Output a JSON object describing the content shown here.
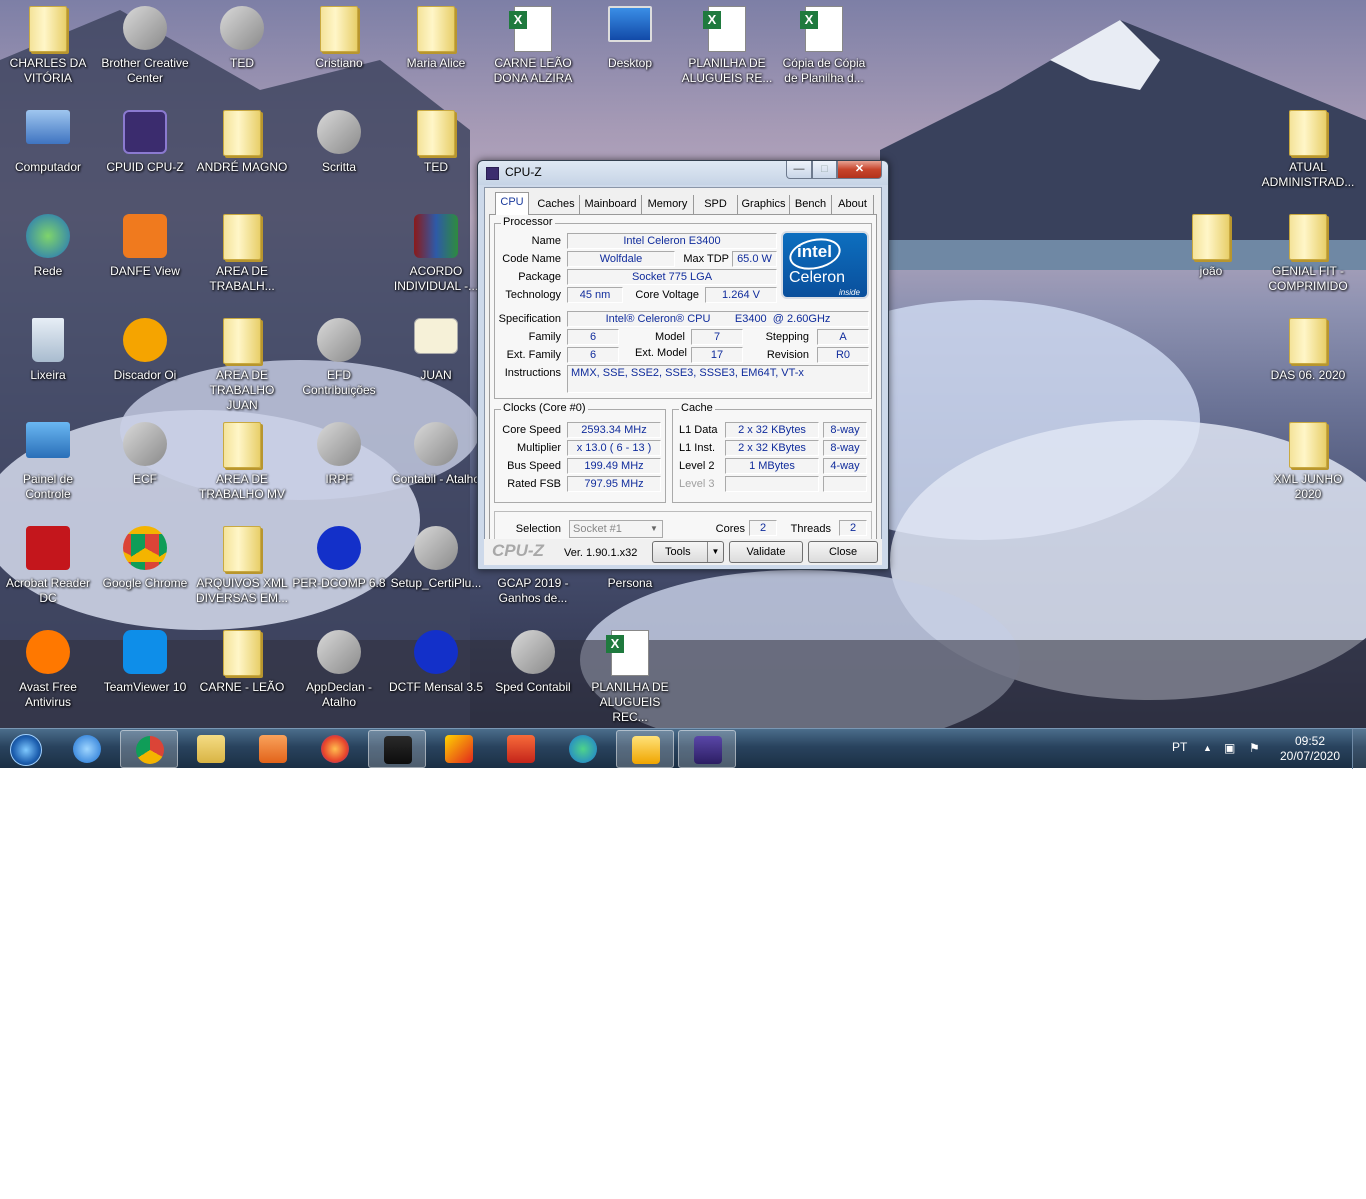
{
  "desktop_icons": [
    {
      "label": "CHARLES DA\nVITÓRIA",
      "icon": "user-folder-icon",
      "col": 0,
      "row": 0
    },
    {
      "label": "Brother Creative\nCenter",
      "icon": "brother-icon",
      "col": 1,
      "row": 0
    },
    {
      "label": "TED",
      "icon": "ted-app-icon",
      "col": 2,
      "row": 0
    },
    {
      "label": "Cristiano",
      "icon": "folder-icon",
      "col": 3,
      "row": 0
    },
    {
      "label": "Maria Alice",
      "icon": "folder-icon",
      "col": 4,
      "row": 0
    },
    {
      "label": "CARNE LEÃO\nDONA ALZIRA",
      "icon": "excel-icon",
      "col": 5,
      "row": 0
    },
    {
      "label": "Desktop",
      "icon": "monitor-icon",
      "col": 6,
      "row": 0
    },
    {
      "label": "PLANILHA DE\nALUGUEIS RE...",
      "icon": "excel-icon",
      "col": 7,
      "row": 0
    },
    {
      "label": "Cópia de Cópia\nde Planilha d...",
      "icon": "excel-icon",
      "col": 8,
      "row": 0
    },
    {
      "label": "Computador",
      "icon": "computer-icon",
      "col": 0,
      "row": 1
    },
    {
      "label": "CPUID CPU-Z",
      "icon": "cpuz-icon",
      "col": 1,
      "row": 1
    },
    {
      "label": "ANDRÉ MAGNO",
      "icon": "folder-icon",
      "col": 2,
      "row": 1
    },
    {
      "label": "Scritta",
      "icon": "scritta-icon",
      "col": 3,
      "row": 1
    },
    {
      "label": "TED",
      "icon": "folder-icon",
      "col": 4,
      "row": 1
    },
    {
      "label": "Rede",
      "icon": "network-icon",
      "col": 0,
      "row": 2
    },
    {
      "label": "DANFE View",
      "icon": "danfe-icon",
      "col": 1,
      "row": 2
    },
    {
      "label": "AREA DE\nTRABALH...",
      "icon": "folder-icon",
      "col": 2,
      "row": 2
    },
    {
      "label": "ACORDO\nINDIVIDUAL -...",
      "icon": "winrar-icon",
      "col": 4,
      "row": 2
    },
    {
      "label": "Lixeira",
      "icon": "recycle-bin-icon",
      "col": 0,
      "row": 3
    },
    {
      "label": "Discador Oi",
      "icon": "oi-icon",
      "col": 1,
      "row": 3
    },
    {
      "label": "AREA DE\nTRABALHO JUAN",
      "icon": "folder-icon",
      "col": 2,
      "row": 3
    },
    {
      "label": "EFD\nContribuições",
      "icon": "efd-icon",
      "col": 3,
      "row": 3
    },
    {
      "label": "JUAN",
      "icon": "certificate-icon",
      "col": 4,
      "row": 3
    },
    {
      "label": "Painel de\nControle",
      "icon": "control-panel-icon",
      "col": 0,
      "row": 4
    },
    {
      "label": "ECF",
      "icon": "ecf-icon",
      "col": 1,
      "row": 4
    },
    {
      "label": "AREA DE\nTRABALHO MV",
      "icon": "folder-icon",
      "col": 2,
      "row": 4
    },
    {
      "label": "IRPF",
      "icon": "irpf-icon",
      "col": 3,
      "row": 4
    },
    {
      "label": "Contabil - Atalho",
      "icon": "contabil-icon",
      "col": 4,
      "row": 4
    },
    {
      "label": "Acrobat Reader\nDC",
      "icon": "acrobat-icon",
      "col": 0,
      "row": 5
    },
    {
      "label": "Google Chrome",
      "icon": "chrome-icon",
      "col": 1,
      "row": 5
    },
    {
      "label": "ARQUIVOS XML\nDIVERSAS EM...",
      "icon": "folder-icon",
      "col": 2,
      "row": 5
    },
    {
      "label": "PER-DCOMP 6.8",
      "icon": "receita-icon",
      "col": 3,
      "row": 5
    },
    {
      "label": "Setup_CertiPlu...",
      "icon": "certiplus-icon",
      "col": 4,
      "row": 5
    },
    {
      "label": "GCAP 2019 -\nGanhos de...",
      "icon": "gcap-icon",
      "col": 5,
      "row": 5
    },
    {
      "label": "Persona",
      "icon": "persona-icon",
      "col": 6,
      "row": 5
    },
    {
      "label": "Avast Free\nAntivirus",
      "icon": "avast-icon",
      "col": 0,
      "row": 6
    },
    {
      "label": "TeamViewer 10",
      "icon": "teamviewer-icon",
      "col": 1,
      "row": 6
    },
    {
      "label": "CARNE - LEÃO",
      "icon": "folder-icon",
      "col": 2,
      "row": 6
    },
    {
      "label": "AppDeclan -\nAtalho",
      "icon": "appdeclan-icon",
      "col": 3,
      "row": 6
    },
    {
      "label": "DCTF Mensal 3.5",
      "icon": "receita-icon",
      "col": 4,
      "row": 6
    },
    {
      "label": "Sped Contabil",
      "icon": "sped-icon",
      "col": 5,
      "row": 6
    },
    {
      "label": "PLANILHA DE\nALUGUEIS REC...",
      "icon": "excel-icon",
      "col": 6,
      "row": 6
    },
    {
      "label": "ATUAL\nADMINISTRAD...",
      "icon": "folder-icon",
      "col": 13,
      "row": 1
    },
    {
      "label": "joão",
      "icon": "folder-icon",
      "col": 12,
      "row": 2
    },
    {
      "label": "GENIAL FIT -\nCOMPRIMIDO",
      "icon": "folder-icon",
      "col": 13,
      "row": 2
    },
    {
      "label": "DAS 06. 2020",
      "icon": "folder-icon",
      "col": 13,
      "row": 3
    },
    {
      "label": "XML JUNHO 2020",
      "icon": "folder-icon",
      "col": 13,
      "row": 4
    }
  ],
  "cpuz": {
    "title": "CPU-Z",
    "tabs": [
      "CPU",
      "Caches",
      "Mainboard",
      "Memory",
      "SPD",
      "Graphics",
      "Bench",
      "About"
    ],
    "processor": {
      "group": "Processor",
      "name_label": "Name",
      "name": "Intel Celeron E3400",
      "codename_label": "Code Name",
      "codename": "Wolfdale",
      "maxtdp_label": "Max TDP",
      "maxtdp": "65.0 W",
      "package_label": "Package",
      "package": "Socket 775 LGA",
      "technology_label": "Technology",
      "technology": "45 nm",
      "corevoltage_label": "Core Voltage",
      "corevoltage": "1.264 V",
      "spec_label": "Specification",
      "spec": "Intel® Celeron® CPU        E3400  @ 2.60GHz",
      "family_label": "Family",
      "family": "6",
      "model_label": "Model",
      "model": "7",
      "stepping_label": "Stepping",
      "stepping": "A",
      "extfamily_label": "Ext. Family",
      "extfamily": "6",
      "extmodel_label": "Ext. Model",
      "extmodel": "17",
      "revision_label": "Revision",
      "revision": "R0",
      "instructions_label": "Instructions",
      "instructions": "MMX, SSE, SSE2, SSE3, SSSE3, EM64T, VT-x",
      "logo_brand": "intel",
      "logo_product": "Celeron",
      "logo_tag": "inside"
    },
    "clocks": {
      "group": "Clocks (Core #0)",
      "corespeed_label": "Core Speed",
      "corespeed": "2593.34 MHz",
      "multiplier_label": "Multiplier",
      "multiplier": "x 13.0 ( 6 - 13 )",
      "busspeed_label": "Bus Speed",
      "busspeed": "199.49 MHz",
      "ratedfsb_label": "Rated FSB",
      "ratedfsb": "797.95 MHz"
    },
    "cache": {
      "group": "Cache",
      "l1data_label": "L1 Data",
      "l1data": "2 x 32 KBytes",
      "l1data_way": "8-way",
      "l1inst_label": "L1 Inst.",
      "l1inst": "2 x 32 KBytes",
      "l1inst_way": "8-way",
      "level2_label": "Level 2",
      "level2": "1 MBytes",
      "level2_way": "4-way",
      "level3_label": "Level 3"
    },
    "selection_label": "Selection",
    "selection": "Socket #1",
    "cores_label": "Cores",
    "cores": "2",
    "threads_label": "Threads",
    "threads": "2",
    "brand": "CPU-Z",
    "version": "Ver. 1.90.1.x32",
    "tools_label": "Tools",
    "validate_label": "Validate",
    "close_label": "Close"
  },
  "taskbar": {
    "items": [
      "start-orb-icon",
      "internet-explorer-icon",
      "chrome-icon",
      "explorer-icon",
      "media-player-icon",
      "firefox-icon",
      "zeus-icon",
      "scritta-icon",
      "cc4-icon",
      "edge-icon",
      "outlook-icon",
      "cpuz-icon"
    ],
    "active": [
      "chrome-icon",
      "zeus-icon",
      "outlook-icon",
      "cpuz-icon"
    ],
    "lang": "PT",
    "time": "09:52",
    "date": "20/07/2020"
  },
  "colors": {
    "accent": "#102c9c",
    "taskbar": "#29435e",
    "close": "#c7442b"
  }
}
